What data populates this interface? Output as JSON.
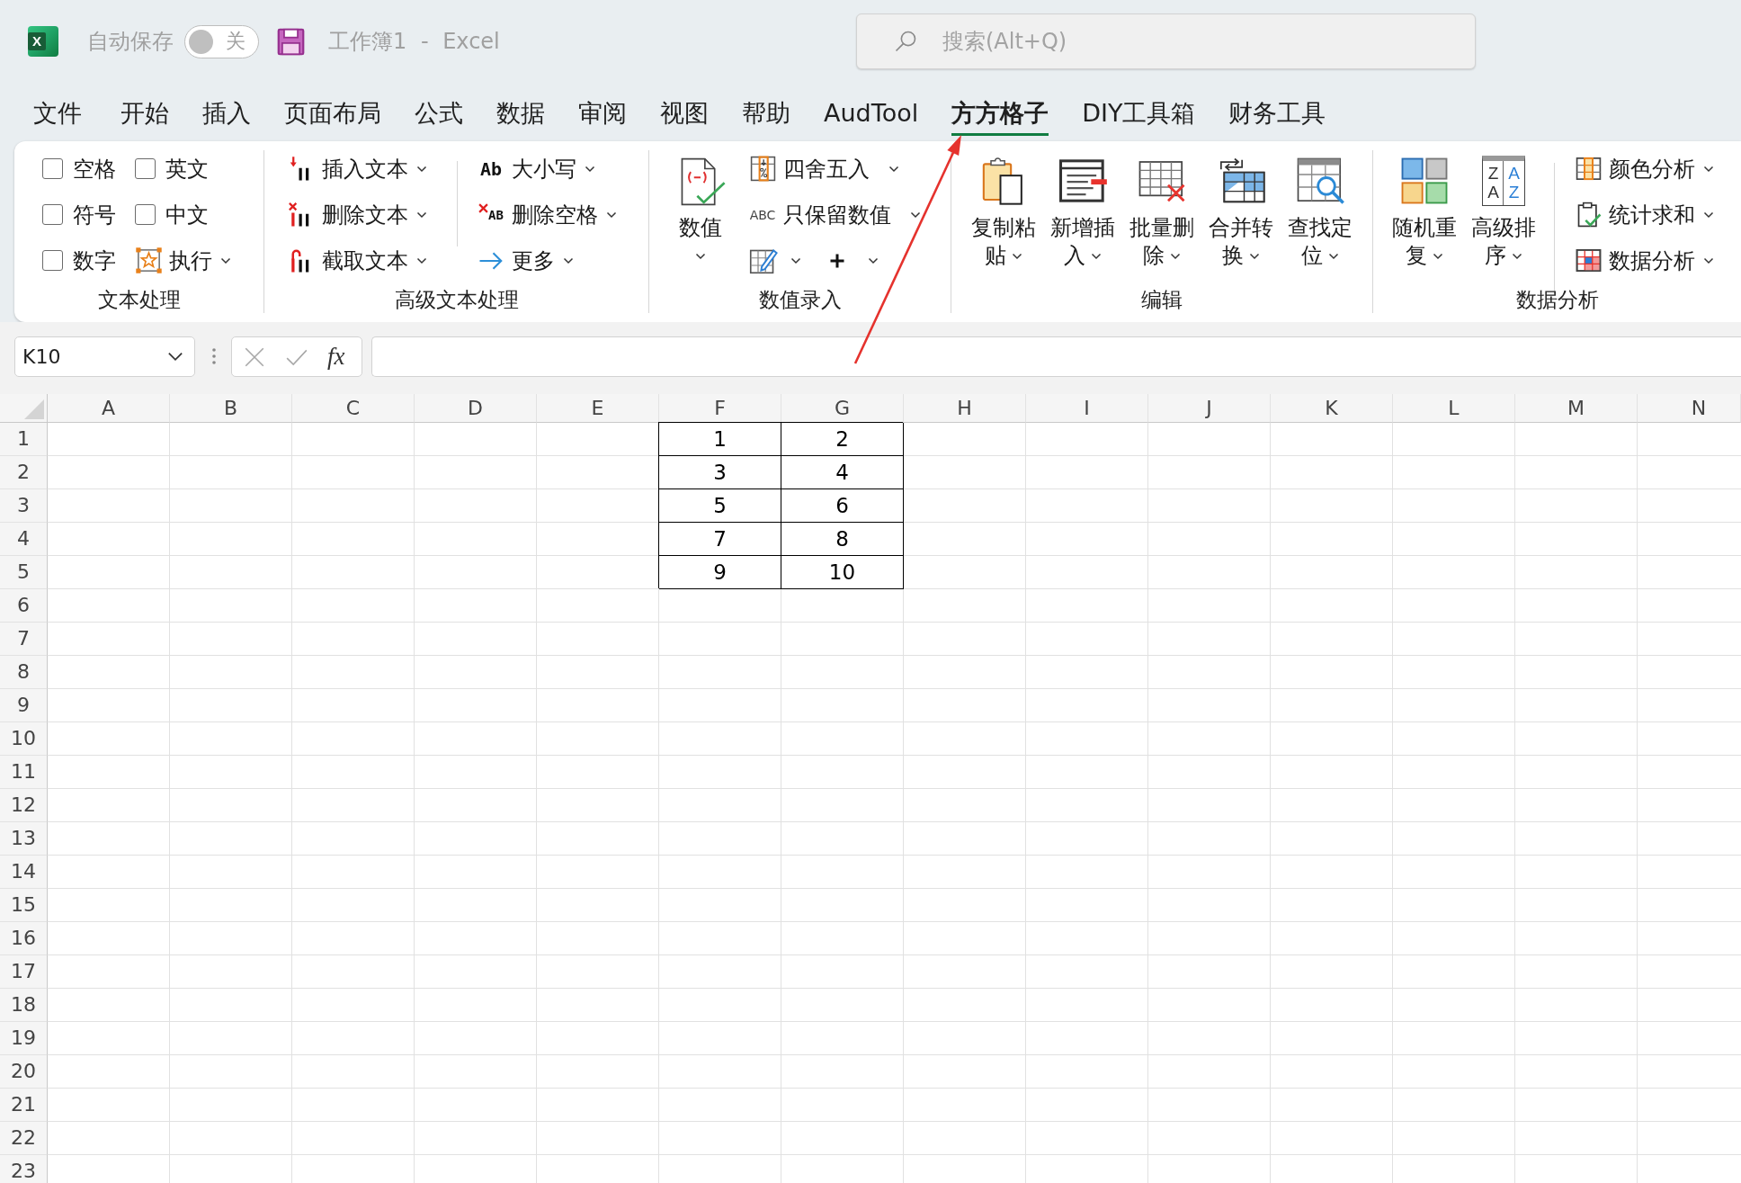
{
  "title_bar": {
    "app_logo": "X",
    "autosave_label": "自动保存",
    "autosave_toggle": {
      "label": "关",
      "on": false
    },
    "window_title": "工作簿1 - Excel",
    "search": {
      "placeholder": "搜索(Alt+Q)"
    }
  },
  "tabs": [
    {
      "label": "文件",
      "selected": false
    },
    {
      "label": "开始",
      "selected": false
    },
    {
      "label": "插入",
      "selected": false
    },
    {
      "label": "页面布局",
      "selected": false
    },
    {
      "label": "公式",
      "selected": false
    },
    {
      "label": "数据",
      "selected": false
    },
    {
      "label": "审阅",
      "selected": false
    },
    {
      "label": "视图",
      "selected": false
    },
    {
      "label": "帮助",
      "selected": false
    },
    {
      "label": "AudTool",
      "selected": false
    },
    {
      "label": "方方格子",
      "selected": true
    },
    {
      "label": "DIY工具箱",
      "selected": false
    },
    {
      "label": "财务工具",
      "selected": false
    }
  ],
  "ribbon": {
    "text_group": {
      "label": "文本处理",
      "checkboxes": [
        {
          "label": "空格",
          "checked": false
        },
        {
          "label": "英文",
          "checked": false
        },
        {
          "label": "符号",
          "checked": false
        },
        {
          "label": "中文",
          "checked": false
        },
        {
          "label": "数字",
          "checked": false
        }
      ],
      "run_button": {
        "label": "执行"
      }
    },
    "advanced_text_group": {
      "label": "高级文本处理",
      "column_1": [
        {
          "label": "插入文本"
        },
        {
          "label": "删除文本"
        },
        {
          "label": "截取文本"
        }
      ],
      "column_2": [
        {
          "icon_text": "Ab",
          "label": "大小写"
        },
        {
          "icon_text": "AB",
          "label": "删除空格"
        },
        {
          "label": "更多"
        }
      ]
    },
    "value_entry_group": {
      "label": "数值录入",
      "value_button": {
        "label": "数值"
      },
      "items": [
        {
          "label": "四舍五入"
        },
        {
          "icon_text": "ABC",
          "label": "只保留数值"
        }
      ]
    },
    "edit_group": {
      "label": "编辑",
      "buttons": [
        {
          "label": "复制粘贴"
        },
        {
          "label": "新增插入"
        },
        {
          "label": "批量删除"
        },
        {
          "label": "合并转换"
        },
        {
          "label": "查找定位"
        }
      ]
    },
    "analysis_group": {
      "label": "数据分析",
      "buttons": [
        {
          "label": "随机重复"
        },
        {
          "label": "高级排序",
          "icon_letters": [
            "ZA",
            "AZ"
          ]
        }
      ],
      "items": [
        {
          "label": "颜色分析"
        },
        {
          "label": "统计求和"
        },
        {
          "label": "数据分析"
        }
      ]
    }
  },
  "formula_bar": {
    "name_box": "K10",
    "function_label": "fx"
  },
  "sheet": {
    "columns": [
      {
        "label": "A"
      },
      {
        "label": "B"
      },
      {
        "label": "C"
      },
      {
        "label": "D"
      },
      {
        "label": "E"
      },
      {
        "label": "F",
        "cells": [
          "1",
          "3",
          "5",
          "7",
          "9"
        ]
      },
      {
        "label": "G",
        "cells": [
          "2",
          "4",
          "6",
          "8",
          "10"
        ]
      },
      {
        "label": "H"
      },
      {
        "label": "I"
      },
      {
        "label": "J"
      },
      {
        "label": "K"
      },
      {
        "label": "L"
      },
      {
        "label": "M"
      },
      {
        "label": "N"
      }
    ],
    "rows": [
      "1",
      "2",
      "3",
      "4",
      "5",
      "6",
      "7",
      "8",
      "9",
      "10",
      "11",
      "12",
      "13",
      "14",
      "15",
      "16",
      "17",
      "18",
      "19",
      "20",
      "21",
      "22",
      "23"
    ]
  }
}
